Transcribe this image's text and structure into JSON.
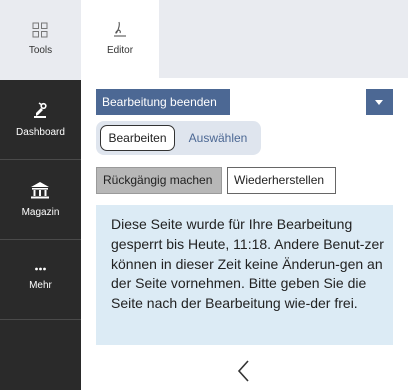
{
  "rail": {
    "tools_label": "Tools",
    "items": [
      {
        "label": "Dashboard",
        "icon": "dashboard-icon"
      },
      {
        "label": "Magazin",
        "icon": "museum-icon"
      },
      {
        "label": "Mehr",
        "icon": "more-dots-icon"
      }
    ]
  },
  "tabs": {
    "editor_label": "Editor"
  },
  "toolbar": {
    "end_editing_label": "Bearbeitung beenden"
  },
  "mode_toggle": {
    "edit_label": "Bearbeiten",
    "select_label": "Auswählen",
    "active": "edit"
  },
  "history": {
    "undo_label": "Rückgängig machen",
    "redo_label": "Wiederherstellen"
  },
  "notice": {
    "text": "Diese Seite wurde für Ihre Bearbeitung gesperrt bis Heute, 11:18. Andere Benut-zer können in dieser Zeit keine Änderun-gen an der Seite vornehmen. Bitte geben Sie die Seite nach der Bearbeitung wie-der frei."
  },
  "colors": {
    "accent": "#4c6894",
    "rail_bg": "#2a2a2a",
    "notice_bg": "#dcebf5",
    "tabbar_bg": "#e9ebf0"
  }
}
